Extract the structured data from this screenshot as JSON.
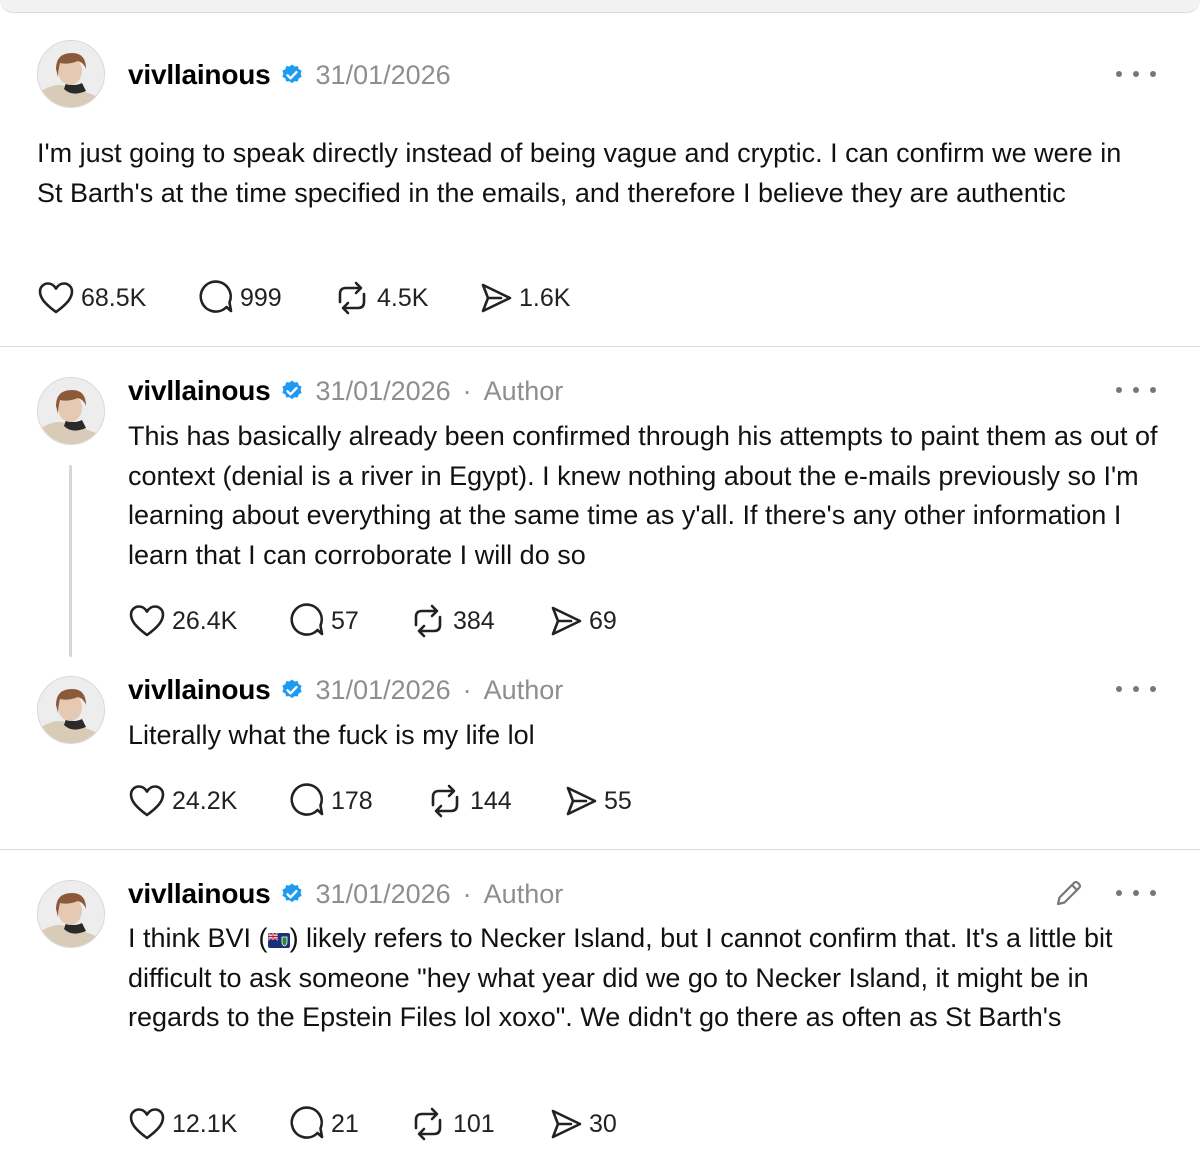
{
  "posts": [
    {
      "username": "vivllainous",
      "date": "31/01/2026",
      "author_tag": "",
      "text": "I'm just going to speak directly instead of being vague and cryptic. I can confirm we were in St Barth's at the time specified in the emails, and therefore I believe they are authentic",
      "likes": "68.5K",
      "replies": "999",
      "reposts": "4.5K",
      "shares": "1.6K"
    },
    {
      "username": "vivllainous",
      "date": "31/01/2026",
      "author_tag": "Author",
      "text": "This has basically already been confirmed through his attempts to paint them as out of context (denial is a river in Egypt). I knew nothing about the e-mails previously so I'm learning about everything at the same time as y'all. If there's any other information I learn that I can corroborate I will do so",
      "likes": "26.4K",
      "replies": "57",
      "reposts": "384",
      "shares": "69"
    },
    {
      "username": "vivllainous",
      "date": "31/01/2026",
      "author_tag": "Author",
      "text": "Literally what the fuck is my life lol",
      "likes": "24.2K",
      "replies": "178",
      "reposts": "144",
      "shares": "55"
    },
    {
      "username": "vivllainous",
      "date": "31/01/2026",
      "author_tag": "Author",
      "text_before_flag": "I think BVI (",
      "flag_icon": "british-virgin-islands-flag",
      "text_after_flag": ") likely refers to Necker Island, but I cannot confirm that. It's a little bit difficult to ask someone \"hey what year did we go to Necker Island, it might be in regards to the Epstein Files lol xoxo\". We didn't go there as often as St Barth's",
      "likes": "12.1K",
      "replies": "21",
      "reposts": "101",
      "shares": "30"
    }
  ],
  "separator": "·",
  "colors": {
    "verified": "#1d9bf0",
    "muted": "#8e8e8e",
    "divider": "#dcdcdc"
  }
}
